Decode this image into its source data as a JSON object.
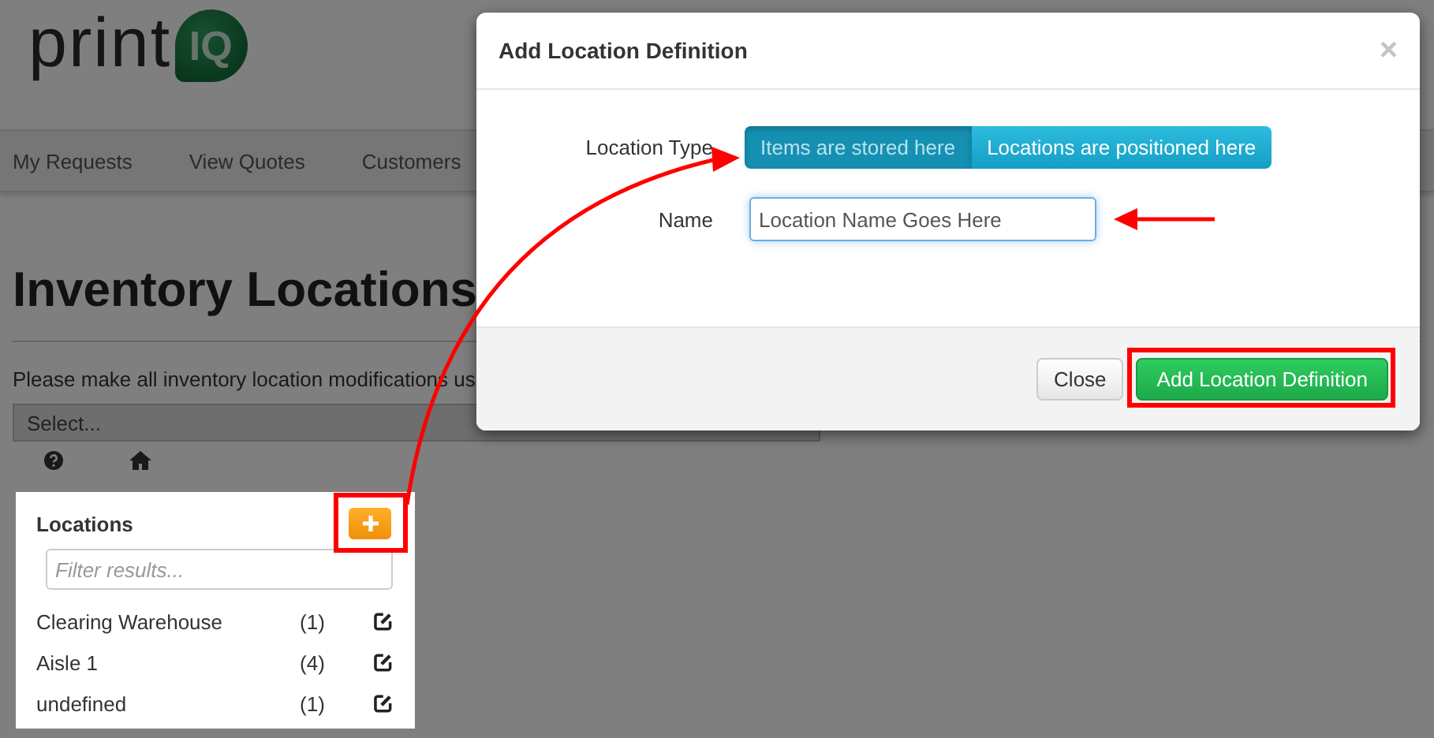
{
  "logo": {
    "word": "print",
    "mark": "IQ"
  },
  "nav": [
    {
      "label": "My Requests"
    },
    {
      "label": "View Quotes"
    },
    {
      "label": "Customers"
    }
  ],
  "page": {
    "title": "Inventory Locations",
    "notice": "Please make all inventory location modifications us",
    "select": {
      "placeholder": "Select..."
    }
  },
  "locations_panel": {
    "title": "Locations",
    "filter": {
      "placeholder": "Filter results..."
    },
    "items": [
      {
        "name": "Clearing Warehouse",
        "count": "(1)"
      },
      {
        "name": "Aisle 1",
        "count": "(4)"
      },
      {
        "name": "undefined",
        "count": "(1)"
      }
    ]
  },
  "dialog": {
    "title": "Add Location Definition",
    "close_glyph": "×",
    "location_type": {
      "label": "Location Type",
      "options": [
        {
          "label": "Items are stored here",
          "selected": true
        },
        {
          "label": "Locations are positioned here",
          "selected": false
        }
      ]
    },
    "name": {
      "label": "Name",
      "value": "Location Name Goes Here"
    },
    "buttons": [
      {
        "label": "Close",
        "kind": "default"
      },
      {
        "label": "Add Location Definition",
        "kind": "success"
      }
    ]
  }
}
